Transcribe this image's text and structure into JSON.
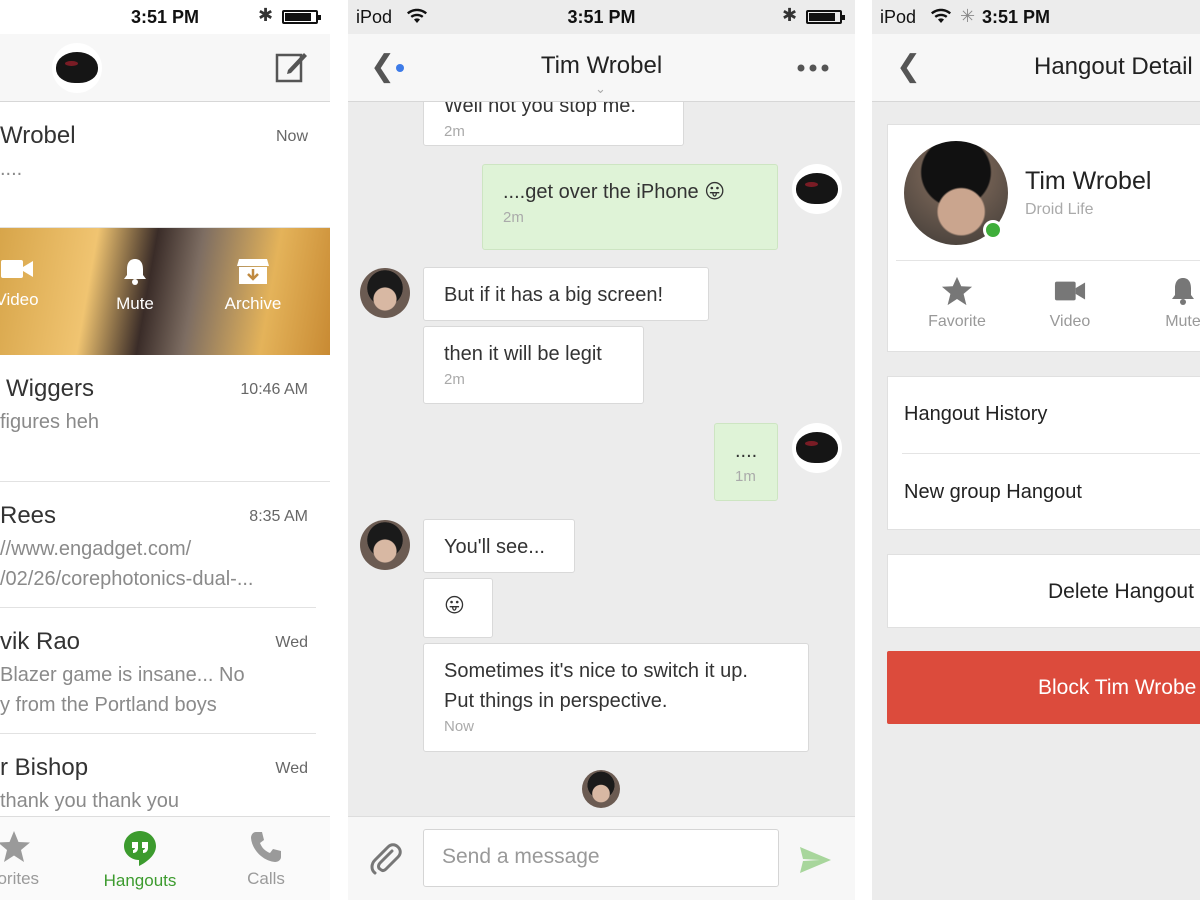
{
  "status": {
    "time": "3:51 PM",
    "carrier": "iPod"
  },
  "list_panel": {
    "conversations": [
      {
        "name": "Wrobel",
        "time": "Now",
        "snippet": "...."
      },
      {
        "name": "Wiggers",
        "time": "10:46 AM",
        "snippet": "figures heh"
      },
      {
        "name": "Rees",
        "time": "8:35 AM",
        "snippet_lines": [
          "//www.engadget.com/",
          "/02/26/corephotonics-dual-..."
        ]
      },
      {
        "name": "vik Rao",
        "time": "Wed",
        "snippet_lines": [
          "Blazer game is insane... No",
          "y from the Portland boys"
        ]
      },
      {
        "name": "r Bishop",
        "time": "Wed",
        "snippet": "thank you thank you"
      }
    ],
    "swipe_actions": [
      "Video",
      "Mute",
      "Archive"
    ],
    "tabs": [
      {
        "label": "vorites",
        "icon": "star-icon"
      },
      {
        "label": "Hangouts",
        "icon": "hangouts-icon",
        "active": true
      },
      {
        "label": "Calls",
        "icon": "phone-icon"
      }
    ],
    "accent": "#3c9b2e"
  },
  "chat_panel": {
    "title": "Tim Wrobel",
    "messages": [
      {
        "text": "Well not you stop me.",
        "time": "2m",
        "mine": false
      },
      {
        "text": "....get over the iPhone 😛",
        "time": "2m",
        "mine": true
      },
      {
        "text": "But if it has a big screen!",
        "mine": false
      },
      {
        "text": "then it will be legit",
        "time": "2m",
        "mine": false
      },
      {
        "text": "....",
        "time": "1m",
        "mine": true
      },
      {
        "text": "You'll see...",
        "mine": false
      },
      {
        "text": "😛",
        "mine": false
      },
      {
        "text_lines": [
          "Sometimes it's nice to switch it up.",
          "Put things in perspective."
        ],
        "time": "Now",
        "mine": false
      }
    ],
    "composer_placeholder": "Send a message",
    "mine_bubble_color": "#dff3d7"
  },
  "details_panel": {
    "title": "Hangout Detail",
    "contact_name": "Tim Wrobel",
    "contact_sub": "Droid Life",
    "actions": [
      "Favorite",
      "Video",
      "Mute"
    ],
    "rows": [
      "Hangout History",
      "New group Hangout"
    ],
    "delete_label": "Delete Hangout",
    "block_label": "Block Tim Wrobe",
    "block_color": "#dc4b3c"
  }
}
